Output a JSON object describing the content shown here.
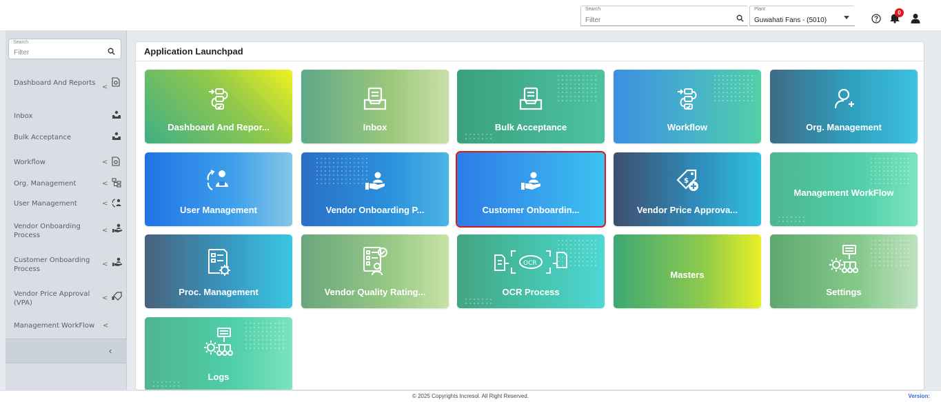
{
  "header": {
    "search": {
      "label": "Search",
      "placeholder": "Filter"
    },
    "plant": {
      "label": "Plant",
      "value": "Guwahati Fans - (5010)"
    },
    "notification_count": "0",
    "icons": [
      "search-icon",
      "help-icon",
      "bell-icon",
      "user-icon"
    ]
  },
  "sidebar": {
    "search": {
      "label": "Search",
      "placeholder": "Filter"
    },
    "items": [
      {
        "label": "Dashboard And Reports",
        "has_arrow": true,
        "icon": "report-icon"
      },
      {
        "label": "Inbox",
        "has_arrow": false,
        "icon": "inbox-tray-icon"
      },
      {
        "label": "Bulk Acceptance",
        "has_arrow": false,
        "icon": "inbox-tray-icon"
      },
      {
        "label": "Workflow",
        "has_arrow": true,
        "icon": "report-icon"
      },
      {
        "label": "Org. Management",
        "has_arrow": true,
        "icon": "org-chart-icon"
      },
      {
        "label": "User Management",
        "has_arrow": true,
        "icon": "users-cycle-icon"
      },
      {
        "label": "Vendor Onboarding Process",
        "has_arrow": true,
        "icon": "hand-user-icon"
      },
      {
        "label": "Customer Onboarding Process",
        "has_arrow": true,
        "icon": "hand-user-icon"
      },
      {
        "label": "Vendor Price Approval (VPA)",
        "has_arrow": true,
        "icon": "price-approval-icon"
      },
      {
        "label": "Management WorkFlow",
        "has_arrow": true,
        "icon": ""
      }
    ],
    "collapse_label": "‹"
  },
  "main": {
    "title": "Application Launchpad",
    "tiles": [
      {
        "label": "Dashboard And Repor...",
        "icon": "workflow-list-icon",
        "gradient": "lime"
      },
      {
        "label": "Inbox",
        "icon": "inbox-icon",
        "gradient": "olive"
      },
      {
        "label": "Bulk Acceptance",
        "icon": "inbox-icon",
        "gradient": "greenteal"
      },
      {
        "label": "Workflow",
        "icon": "workflow-list-icon",
        "gradient": "bluegreen"
      },
      {
        "label": "Org. Management",
        "icon": "add-user-icon",
        "gradient": "slateteal"
      },
      {
        "label": "User Management",
        "icon": "user-sync-icon",
        "gradient": "blue"
      },
      {
        "label": "Vendor Onboarding P...",
        "icon": "hand-user-icon",
        "gradient": "deepblue"
      },
      {
        "label": "Customer Onboardin...",
        "icon": "hand-user-icon",
        "gradient": "brightblue",
        "selected": true
      },
      {
        "label": "Vendor Price Approva...",
        "icon": "price-tag-icon",
        "gradient": "slateblue"
      },
      {
        "label": "Management WorkFlow",
        "icon": "",
        "gradient": "mint"
      },
      {
        "label": "Proc. Management",
        "icon": "document-gear-icon",
        "gradient": "slatecyan"
      },
      {
        "label": "Vendor Quality Rating...",
        "icon": "checklist-user-icon",
        "gradient": "palegreen"
      },
      {
        "label": "OCR Process",
        "icon": "ocr-scan-icon",
        "gradient": "teal"
      },
      {
        "label": "Masters",
        "icon": "",
        "gradient": "yellowgreen"
      },
      {
        "label": "Settings",
        "icon": "gear-network-icon",
        "gradient": "greenpale"
      },
      {
        "label": "Logs",
        "icon": "gear-network-icon",
        "gradient": "mint"
      }
    ]
  },
  "footer": {
    "copyright": "© 2025 Copyrights Incresol. All Right Reserved.",
    "version": "Version:"
  },
  "colors": {
    "selected_outline": "#e0161b",
    "notification_badge": "#e0161b",
    "version_link": "#2a6fd6"
  }
}
